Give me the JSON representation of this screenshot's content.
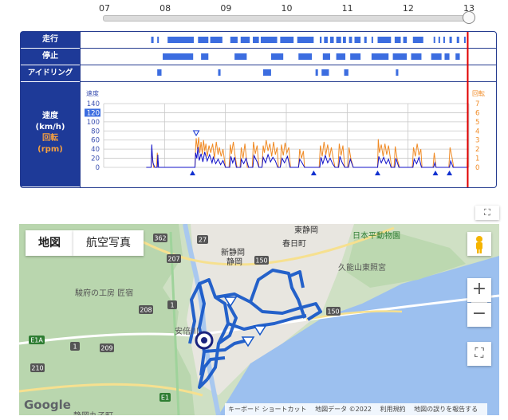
{
  "timeline": {
    "hours": [
      "07",
      "08",
      "09",
      "10",
      "11",
      "12",
      "13"
    ]
  },
  "chart": {
    "rows": [
      {
        "key": "run",
        "label": "走行"
      },
      {
        "key": "stop",
        "label": "停止"
      },
      {
        "key": "idle",
        "label": "アイドリング"
      }
    ],
    "speed_label": "速度",
    "speed_unit": "(km/h)",
    "rpm_label": "回転",
    "rpm_unit": "(rpm)",
    "axis_left_title": "速度",
    "axis_right_title": "回転",
    "colors": {
      "speed": "#1010c8",
      "rpm": "#f08a24",
      "bar": "#3c6de0",
      "cursor": "#e00000",
      "header": "#1e3a98"
    }
  },
  "chart_data": {
    "type": "line",
    "x_range_hours": [
      7,
      13
    ],
    "y_left": {
      "ticks": [
        0,
        20,
        40,
        60,
        80,
        100,
        120,
        140
      ],
      "range": [
        0,
        140
      ],
      "highlight_tick": 120
    },
    "y_right": {
      "ticks": [
        0,
        1,
        2,
        3,
        4,
        5,
        6,
        7
      ],
      "range": [
        0,
        7
      ]
    },
    "current_time": 12.98,
    "run_segments": [
      [
        7.78,
        7.82
      ],
      [
        7.88,
        7.9
      ],
      [
        8.05,
        8.48
      ],
      [
        8.55,
        8.72
      ],
      [
        8.75,
        8.95
      ],
      [
        9.08,
        9.2
      ],
      [
        9.25,
        9.4
      ],
      [
        9.45,
        9.55
      ],
      [
        9.58,
        9.85
      ],
      [
        9.9,
        10.12
      ],
      [
        10.18,
        10.45
      ],
      [
        10.55,
        10.58
      ],
      [
        10.62,
        10.68
      ],
      [
        10.72,
        10.78
      ],
      [
        10.82,
        10.9
      ],
      [
        10.93,
        10.98
      ],
      [
        11.03,
        11.08
      ],
      [
        11.12,
        11.22
      ],
      [
        11.28,
        11.32
      ],
      [
        11.4,
        11.42
      ],
      [
        11.5,
        11.72
      ],
      [
        11.78,
        11.88
      ],
      [
        11.92,
        11.98
      ],
      [
        12.08,
        12.25
      ],
      [
        12.42,
        12.44
      ],
      [
        12.5,
        12.52
      ],
      [
        12.58,
        12.6
      ],
      [
        12.68,
        12.72
      ],
      [
        12.8,
        12.84
      ],
      [
        12.92,
        12.94
      ]
    ],
    "stop_segments": [
      [
        7.97,
        8.47
      ],
      [
        8.6,
        8.72
      ],
      [
        9.15,
        9.35
      ],
      [
        9.75,
        9.95
      ],
      [
        10.2,
        10.42
      ],
      [
        10.6,
        10.72
      ],
      [
        10.82,
        10.97
      ],
      [
        11.05,
        11.12
      ],
      [
        11.12,
        11.22
      ],
      [
        11.4,
        11.68
      ],
      [
        11.75,
        11.98
      ],
      [
        12.05,
        12.22
      ],
      [
        12.38,
        12.55
      ],
      [
        12.6,
        12.68
      ],
      [
        12.78,
        12.85
      ]
    ],
    "idle_segments": [
      [
        7.88,
        7.95
      ],
      [
        8.88,
        8.92
      ],
      [
        9.62,
        9.75
      ],
      [
        10.48,
        10.52
      ],
      [
        10.58,
        10.7
      ],
      [
        10.95,
        11.02
      ],
      [
        11.8,
        11.84
      ]
    ],
    "event_markers": [
      8.46,
      10.45,
      11.5,
      12.45,
      12.68
    ],
    "speed_series": [
      [
        7.7,
        0
      ],
      [
        7.78,
        0
      ],
      [
        7.79,
        50
      ],
      [
        7.8,
        25
      ],
      [
        7.81,
        10
      ],
      [
        7.84,
        0
      ],
      [
        7.86,
        0
      ],
      [
        7.88,
        0
      ],
      [
        7.89,
        28
      ],
      [
        7.9,
        0
      ],
      [
        8.5,
        0
      ],
      [
        8.51,
        32
      ],
      [
        8.53,
        20
      ],
      [
        8.55,
        45
      ],
      [
        8.57,
        15
      ],
      [
        8.6,
        30
      ],
      [
        8.63,
        12
      ],
      [
        8.66,
        34
      ],
      [
        8.7,
        14
      ],
      [
        8.74,
        28
      ],
      [
        8.78,
        10
      ],
      [
        8.8,
        22
      ],
      [
        8.84,
        8
      ],
      [
        8.88,
        18
      ],
      [
        8.92,
        6
      ],
      [
        8.96,
        15
      ],
      [
        9.0,
        0
      ],
      [
        9.07,
        0
      ],
      [
        9.09,
        24
      ],
      [
        9.12,
        10
      ],
      [
        9.15,
        22
      ],
      [
        9.18,
        0
      ],
      [
        9.25,
        0
      ],
      [
        9.26,
        18
      ],
      [
        9.3,
        8
      ],
      [
        9.34,
        20
      ],
      [
        9.38,
        0
      ],
      [
        9.45,
        0
      ],
      [
        9.47,
        26
      ],
      [
        9.52,
        12
      ],
      [
        9.55,
        0
      ],
      [
        9.6,
        0
      ],
      [
        9.62,
        22
      ],
      [
        9.66,
        10
      ],
      [
        9.7,
        28
      ],
      [
        9.74,
        12
      ],
      [
        9.78,
        22
      ],
      [
        9.82,
        14
      ],
      [
        9.86,
        0
      ],
      [
        9.9,
        0
      ],
      [
        9.93,
        20
      ],
      [
        9.97,
        10
      ],
      [
        10.02,
        24
      ],
      [
        10.06,
        0
      ],
      [
        10.2,
        0
      ],
      [
        10.22,
        18
      ],
      [
        10.26,
        10
      ],
      [
        10.3,
        0
      ],
      [
        10.55,
        0
      ],
      [
        10.57,
        22
      ],
      [
        10.6,
        8
      ],
      [
        10.64,
        26
      ],
      [
        10.68,
        10
      ],
      [
        10.72,
        20
      ],
      [
        10.76,
        8
      ],
      [
        10.8,
        0
      ],
      [
        10.86,
        0
      ],
      [
        10.88,
        24
      ],
      [
        10.92,
        10
      ],
      [
        10.96,
        0
      ],
      [
        11.02,
        0
      ],
      [
        11.05,
        18
      ],
      [
        11.1,
        0
      ],
      [
        11.5,
        0
      ],
      [
        11.52,
        24
      ],
      [
        11.56,
        10
      ],
      [
        11.6,
        22
      ],
      [
        11.64,
        8
      ],
      [
        11.68,
        18
      ],
      [
        11.72,
        0
      ],
      [
        11.78,
        0
      ],
      [
        11.8,
        20
      ],
      [
        11.85,
        0
      ],
      [
        12.08,
        0
      ],
      [
        12.1,
        18
      ],
      [
        12.14,
        8
      ],
      [
        12.18,
        22
      ],
      [
        12.22,
        0
      ],
      [
        12.42,
        0
      ],
      [
        12.44,
        10
      ],
      [
        12.46,
        0
      ],
      [
        12.68,
        0
      ],
      [
        12.7,
        14
      ],
      [
        12.74,
        0
      ],
      [
        12.98,
        0
      ]
    ],
    "rpm_series": [
      [
        7.7,
        0
      ],
      [
        7.78,
        0
      ],
      [
        7.79,
        1.8
      ],
      [
        7.8,
        1.2
      ],
      [
        7.82,
        0
      ],
      [
        7.87,
        0
      ],
      [
        7.88,
        1.6
      ],
      [
        7.9,
        0
      ],
      [
        8.5,
        0
      ],
      [
        8.51,
        2.1
      ],
      [
        8.52,
        3.2
      ],
      [
        8.54,
        2.0
      ],
      [
        8.56,
        3.3
      ],
      [
        8.58,
        1.6
      ],
      [
        8.6,
        2.8
      ],
      [
        8.62,
        1.4
      ],
      [
        8.64,
        3.0
      ],
      [
        8.66,
        1.8
      ],
      [
        8.68,
        2.6
      ],
      [
        8.7,
        1.2
      ],
      [
        8.73,
        2.4
      ],
      [
        8.76,
        1.6
      ],
      [
        8.79,
        2.6
      ],
      [
        8.82,
        1.0
      ],
      [
        8.85,
        2.8
      ],
      [
        8.88,
        1.4
      ],
      [
        8.9,
        2.2
      ],
      [
        8.93,
        1.2
      ],
      [
        8.96,
        2.0
      ],
      [
        9.0,
        0
      ],
      [
        9.06,
        0
      ],
      [
        9.08,
        2.5
      ],
      [
        9.1,
        1.5
      ],
      [
        9.13,
        2.8
      ],
      [
        9.16,
        1.2
      ],
      [
        9.19,
        0
      ],
      [
        9.24,
        0
      ],
      [
        9.26,
        2.2
      ],
      [
        9.29,
        1.0
      ],
      [
        9.32,
        2.6
      ],
      [
        9.36,
        0
      ],
      [
        9.44,
        0
      ],
      [
        9.46,
        2.8
      ],
      [
        9.49,
        1.5
      ],
      [
        9.52,
        2.4
      ],
      [
        9.55,
        0
      ],
      [
        9.6,
        0
      ],
      [
        9.62,
        2.4
      ],
      [
        9.64,
        1.6
      ],
      [
        9.67,
        3.0
      ],
      [
        9.7,
        1.8
      ],
      [
        9.73,
        2.6
      ],
      [
        9.76,
        1.2
      ],
      [
        9.79,
        2.8
      ],
      [
        9.82,
        1.4
      ],
      [
        9.85,
        2.2
      ],
      [
        9.87,
        0
      ],
      [
        9.9,
        0
      ],
      [
        9.92,
        2.5
      ],
      [
        9.95,
        1.3
      ],
      [
        9.98,
        2.7
      ],
      [
        10.01,
        1.6
      ],
      [
        10.04,
        2.2
      ],
      [
        10.07,
        0
      ],
      [
        10.2,
        0
      ],
      [
        10.22,
        2.0
      ],
      [
        10.25,
        1.0
      ],
      [
        10.28,
        1.8
      ],
      [
        10.3,
        0
      ],
      [
        10.54,
        0
      ],
      [
        10.56,
        2.4
      ],
      [
        10.59,
        1.2
      ],
      [
        10.62,
        2.8
      ],
      [
        10.65,
        1.4
      ],
      [
        10.68,
        2.5
      ],
      [
        10.71,
        1.1
      ],
      [
        10.74,
        2.2
      ],
      [
        10.77,
        1.0
      ],
      [
        10.8,
        0
      ],
      [
        10.85,
        0
      ],
      [
        10.87,
        2.6
      ],
      [
        10.9,
        1.3
      ],
      [
        10.93,
        2.4
      ],
      [
        10.96,
        0
      ],
      [
        11.01,
        0
      ],
      [
        11.03,
        2.2
      ],
      [
        11.06,
        1.0
      ],
      [
        11.1,
        0
      ],
      [
        11.5,
        0
      ],
      [
        11.51,
        3.1
      ],
      [
        11.53,
        1.6
      ],
      [
        11.56,
        2.5
      ],
      [
        11.59,
        1.2
      ],
      [
        11.62,
        2.6
      ],
      [
        11.65,
        1.4
      ],
      [
        11.68,
        2.4
      ],
      [
        11.71,
        1.0
      ],
      [
        11.73,
        0
      ],
      [
        11.77,
        0
      ],
      [
        11.79,
        2.3
      ],
      [
        11.82,
        1.0
      ],
      [
        11.86,
        0
      ],
      [
        12.07,
        0
      ],
      [
        12.09,
        2.2
      ],
      [
        12.12,
        1.2
      ],
      [
        12.15,
        2.6
      ],
      [
        12.18,
        1.3
      ],
      [
        12.21,
        2.0
      ],
      [
        12.23,
        0
      ],
      [
        12.41,
        0
      ],
      [
        12.43,
        1.6
      ],
      [
        12.46,
        0
      ],
      [
        12.67,
        0
      ],
      [
        12.69,
        2.2
      ],
      [
        12.72,
        1.2
      ],
      [
        12.75,
        0
      ],
      [
        12.97,
        0
      ],
      [
        12.98,
        3.0
      ],
      [
        12.985,
        0
      ]
    ]
  },
  "map": {
    "tabs": [
      {
        "key": "map",
        "label": "地図"
      },
      {
        "key": "aerial",
        "label": "航空写真"
      }
    ],
    "places": [
      {
        "key": "higashi-shizuoka",
        "label": "東静岡"
      },
      {
        "key": "kasuga",
        "label": "春日町"
      },
      {
        "key": "zoo",
        "label": "日本平動物園"
      },
      {
        "key": "shin-shizuoka",
        "label": "新静岡"
      },
      {
        "key": "shizuoka",
        "label": "静岡"
      },
      {
        "key": "kunozan",
        "label": "久能山東照宮"
      },
      {
        "key": "sunpu",
        "label": "駿府の工房 匠宿"
      },
      {
        "key": "abekawa",
        "label": "安倍川"
      },
      {
        "key": "bottom-town",
        "label": "静岡丸子町"
      }
    ],
    "road_labels": [
      "362",
      "27",
      "207",
      "1",
      "208",
      "E1A",
      "1",
      "209",
      "210",
      "E1",
      "150",
      "150"
    ],
    "zoom_in_label": "+",
    "zoom_out_label": "−",
    "fullscreen_label": "⛶",
    "expand_label": "⛶",
    "logo_label": "Google",
    "footer": {
      "shortcuts": "キーボード ショートカット",
      "mapdata": "地図データ ©2022",
      "terms": "利用規約",
      "report": "地図の誤りを報告する"
    }
  }
}
